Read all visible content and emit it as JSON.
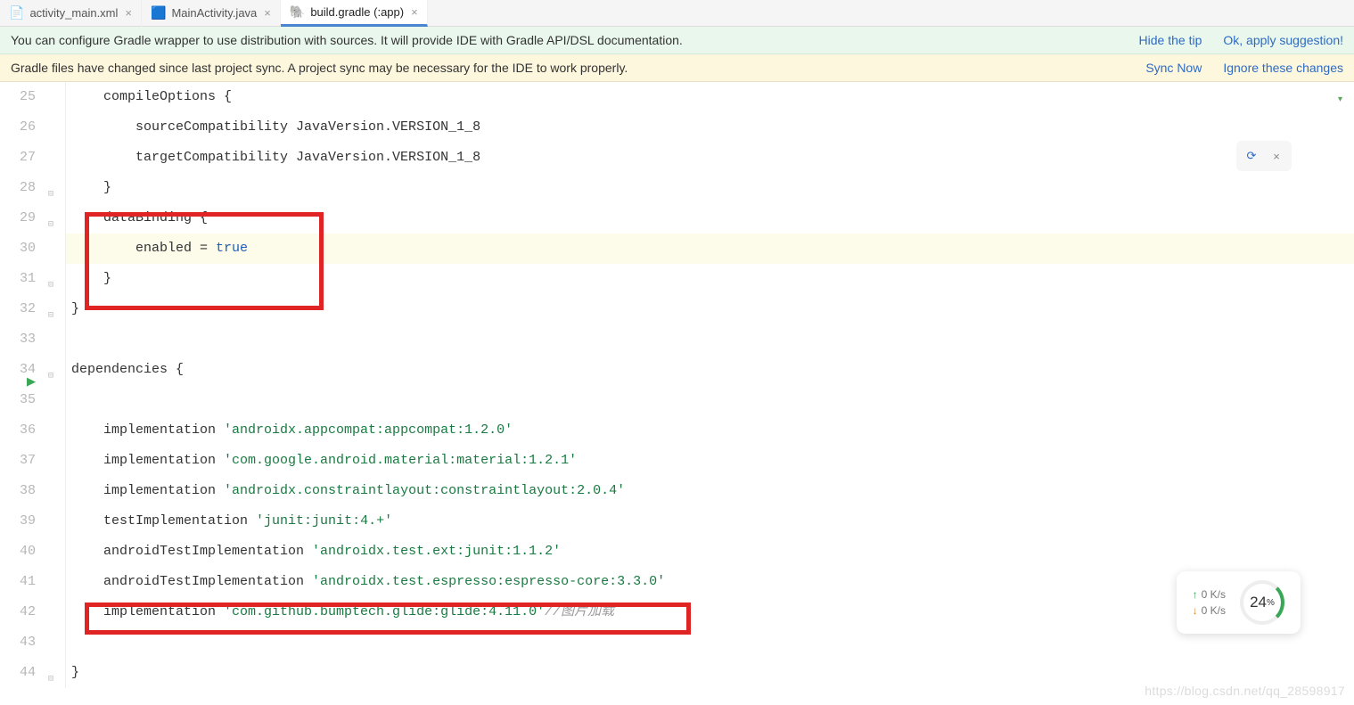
{
  "tabs": [
    {
      "label": "activity_main.xml",
      "icon": "📄"
    },
    {
      "label": "MainActivity.java",
      "icon": "🟦"
    },
    {
      "label": "build.gradle (:app)",
      "icon": "🐘"
    }
  ],
  "banner_green": {
    "text": "You can configure Gradle wrapper to use distribution with sources. It will provide IDE with Gradle API/DSL documentation.",
    "action1": "Hide the tip",
    "action2": "Ok, apply suggestion!"
  },
  "banner_yellow": {
    "text": "Gradle files have changed since last project sync. A project sync may be necessary for the IDE to work properly.",
    "action1": "Sync Now",
    "action2": "Ignore these changes"
  },
  "line_numbers": [
    "25",
    "26",
    "27",
    "28",
    "29",
    "30",
    "31",
    "32",
    "33",
    "34",
    "35",
    "36",
    "37",
    "38",
    "39",
    "40",
    "41",
    "42",
    "43",
    "44"
  ],
  "code": {
    "l25": "    compileOptions {",
    "l26": "        sourceCompatibility JavaVersion.VERSION_1_8",
    "l27": "        targetCompatibility JavaVersion.VERSION_1_8",
    "l28": "    }",
    "l29": "    dataBinding {",
    "l30a": "        enabled = ",
    "l30b": "true",
    "l31": "    }",
    "l32": "}",
    "l33": "",
    "l34": "dependencies {",
    "l35": "",
    "l36a": "    implementation ",
    "l36b": "'androidx.appcompat:appcompat:1.2.0'",
    "l37a": "    implementation ",
    "l37b": "'com.google.android.material:material:1.2.1'",
    "l38a": "    implementation ",
    "l38b": "'androidx.constraintlayout:constraintlayout:2.0.4'",
    "l39a": "    testImplementation ",
    "l39b": "'junit:junit:4.+'",
    "l40a": "    androidTestImplementation ",
    "l40b": "'androidx.test.ext:junit:1.1.2'",
    "l41a": "    androidTestImplementation ",
    "l41b": "'androidx.test.espresso:espresso-core:3.3.0'",
    "l42a": "    implementation ",
    "l42b": "'com.github.bumptech.glide:glide:4.11.0'",
    "l42c": "//图片加载",
    "l43": "",
    "l44": "}"
  },
  "net": {
    "up": "0 K/s",
    "dn": "0 K/s",
    "pct": "24",
    "pct_unit": "%"
  },
  "watermark": "https://blog.csdn.net/qq_28598917"
}
